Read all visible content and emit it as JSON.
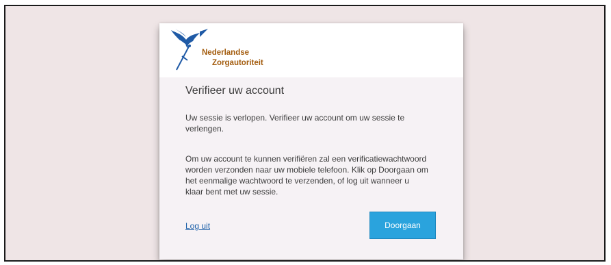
{
  "logo": {
    "icon": "nza-bird-sword-icon",
    "line1": "Nederlandse",
    "line2": "Zorgautoriteit",
    "brand_blue": "#1f5aa6",
    "brand_brown": "#a35c0e"
  },
  "dialog": {
    "title": "Verifieer uw account",
    "paragraph1": "Uw sessie is verlopen. Verifieer uw account om uw sessie te verlengen.",
    "paragraph2": "Om uw account te kunnen verifiëren zal een verificatiewachtwoord worden verzonden naar uw mobiele telefoon. Klik op Doorgaan om het eenmalige wachtwoord te verzenden, of log uit wanneer u klaar bent met uw sessie.",
    "logout_label": "Log uit",
    "continue_label": "Doorgaan"
  },
  "colors": {
    "backdrop": "#efe5e6",
    "button": "#2aa3dd",
    "link": "#1b5fa8"
  }
}
